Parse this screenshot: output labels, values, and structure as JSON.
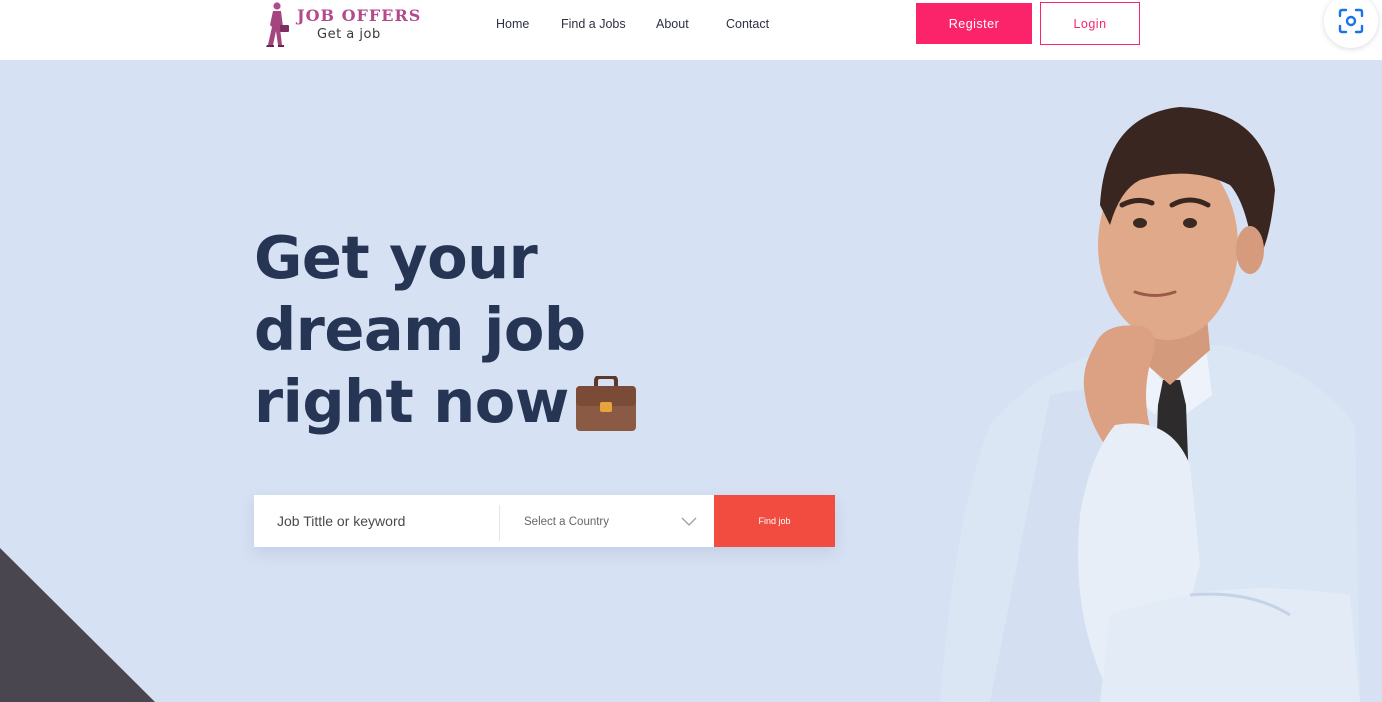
{
  "logo": {
    "title": "JOB OFFERS",
    "subtitle": "Get a job"
  },
  "nav": {
    "items": [
      "Home",
      "Find a Jobs",
      "About",
      "Contact"
    ]
  },
  "auth": {
    "register_label": "Register",
    "login_label": "Login"
  },
  "hero": {
    "line1": "Get your",
    "line2": "dream job",
    "line3": "right now"
  },
  "search": {
    "keyword_placeholder": "Job Tittle or keyword",
    "country_label": "Select a Country",
    "submit_label": "Find job"
  },
  "colors": {
    "accent": "#fb246a",
    "find_button": "#f24b3f",
    "hero_text": "#263553",
    "background": "#d6e1f3"
  }
}
